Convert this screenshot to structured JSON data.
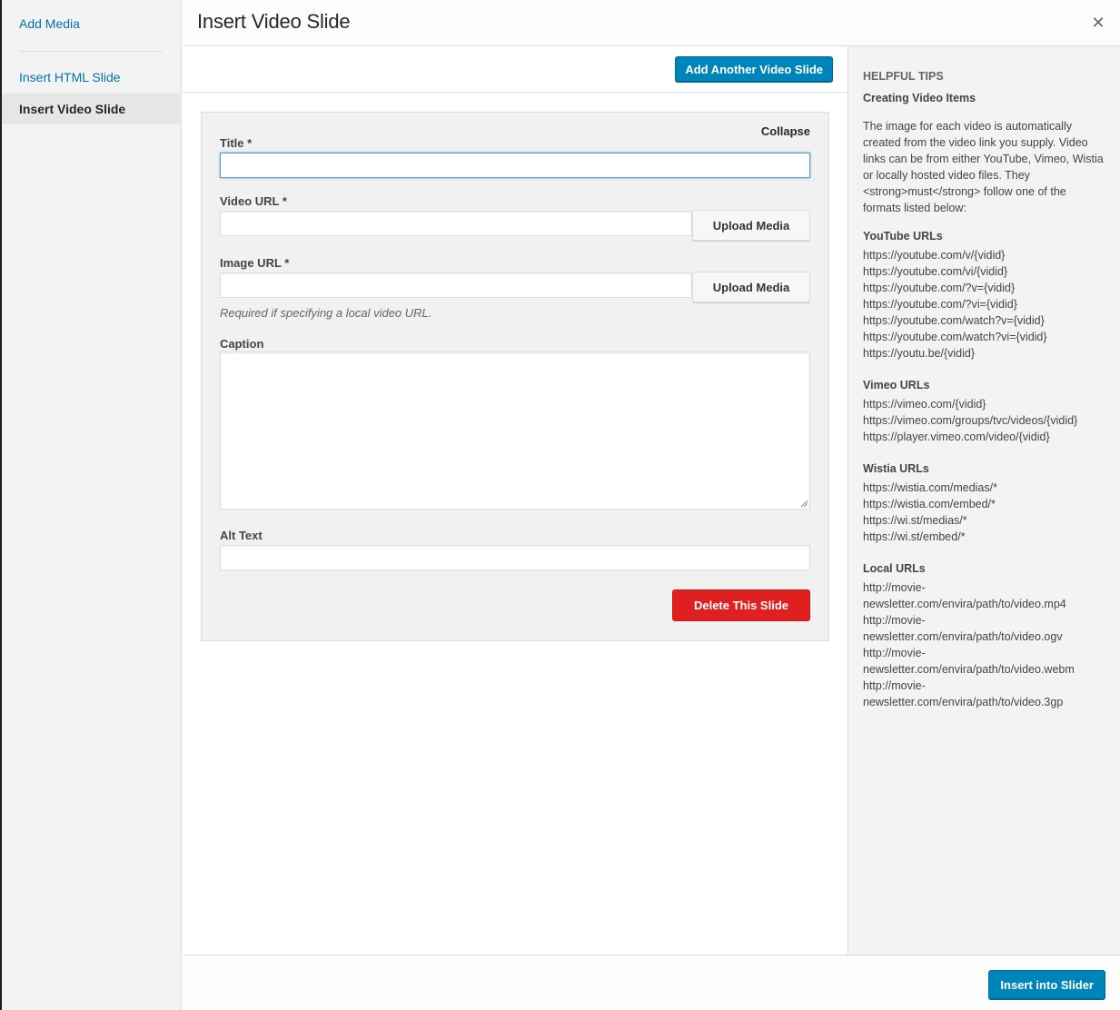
{
  "sidebar": {
    "add_media": "Add Media",
    "items": [
      {
        "label": "Insert HTML Slide",
        "active": false
      },
      {
        "label": "Insert Video Slide",
        "active": true
      }
    ]
  },
  "header": {
    "title": "Insert Video Slide",
    "close_icon": "close-x-icon"
  },
  "toolbar": {
    "add_another_label": "Add Another Video Slide"
  },
  "slide": {
    "collapse_label": "Collapse",
    "title_label": "Title *",
    "title_value": "",
    "video_url_label": "Video URL *",
    "video_url_value": "",
    "image_url_label": "Image URL *",
    "image_url_value": "",
    "upload_media_label": "Upload Media",
    "image_url_help": "Required if specifying a local video URL.",
    "caption_label": "Caption",
    "caption_value": "",
    "alt_text_label": "Alt Text",
    "alt_text_value": "",
    "delete_label": "Delete This Slide"
  },
  "tips": {
    "heading": "HELPFUL TIPS",
    "subheading": "Creating Video Items",
    "intro": "The image for each video is automatically created from the video link you supply. Video links can be from either YouTube, Vimeo, Wistia or locally hosted video files. They <strong>must</strong> follow one of the formats listed below:",
    "groups": [
      {
        "title": "YouTube URLs",
        "urls": [
          "https://youtube.com/v/{vidid}",
          "https://youtube.com/vi/{vidid}",
          "https://youtube.com/?v={vidid}",
          "https://youtube.com/?vi={vidid}",
          "https://youtube.com/watch?v={vidid}",
          "https://youtube.com/watch?vi={vidid}",
          "https://youtu.be/{vidid}"
        ]
      },
      {
        "title": "Vimeo URLs",
        "urls": [
          "https://vimeo.com/{vidid}",
          "https://vimeo.com/groups/tvc/videos/{vidid}",
          "https://player.vimeo.com/video/{vidid}"
        ]
      },
      {
        "title": "Wistia URLs",
        "urls": [
          "https://wistia.com/medias/*",
          "https://wistia.com/embed/*",
          "https://wi.st/medias/*",
          "https://wi.st/embed/*"
        ]
      },
      {
        "title": "Local URLs",
        "urls": [
          "http://movie-newsletter.com/envira/path/to/video.mp4",
          "http://movie-newsletter.com/envira/path/to/video.ogv",
          "http://movie-newsletter.com/envira/path/to/video.webm",
          "http://movie-newsletter.com/envira/path/to/video.3gp"
        ]
      }
    ]
  },
  "footer": {
    "insert_label": "Insert into Slider"
  },
  "colors": {
    "primary": "#0085ba",
    "link": "#0073aa",
    "danger": "#e02020"
  }
}
